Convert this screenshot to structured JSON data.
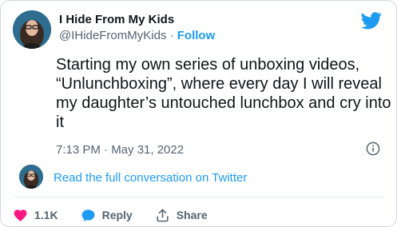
{
  "author": {
    "display_name": "I Hide From My Kids",
    "handle": "@IHideFromMyKids",
    "separator": " · ",
    "follow_label": "Follow"
  },
  "tweet": {
    "text": "Starting my own series of unboxing videos, “Unlunchboxing”, where every day I will reveal my daughter’s untouched lunchbox and cry into it",
    "timestamp": "7:13 PM · May 31, 2022"
  },
  "conversation": {
    "link_label": "Read the full conversation on Twitter"
  },
  "actions": {
    "like_count": "1.1K",
    "reply_label": "Reply",
    "share_label": "Share"
  },
  "colors": {
    "brand": "#1d9bf0",
    "like": "#f91880",
    "muted": "#536471",
    "text": "#0f1419"
  },
  "icons": {
    "logo": "twitter-bird-icon",
    "info": "info-icon",
    "like": "heart-icon",
    "reply": "speech-bubble-icon",
    "share": "share-icon"
  }
}
